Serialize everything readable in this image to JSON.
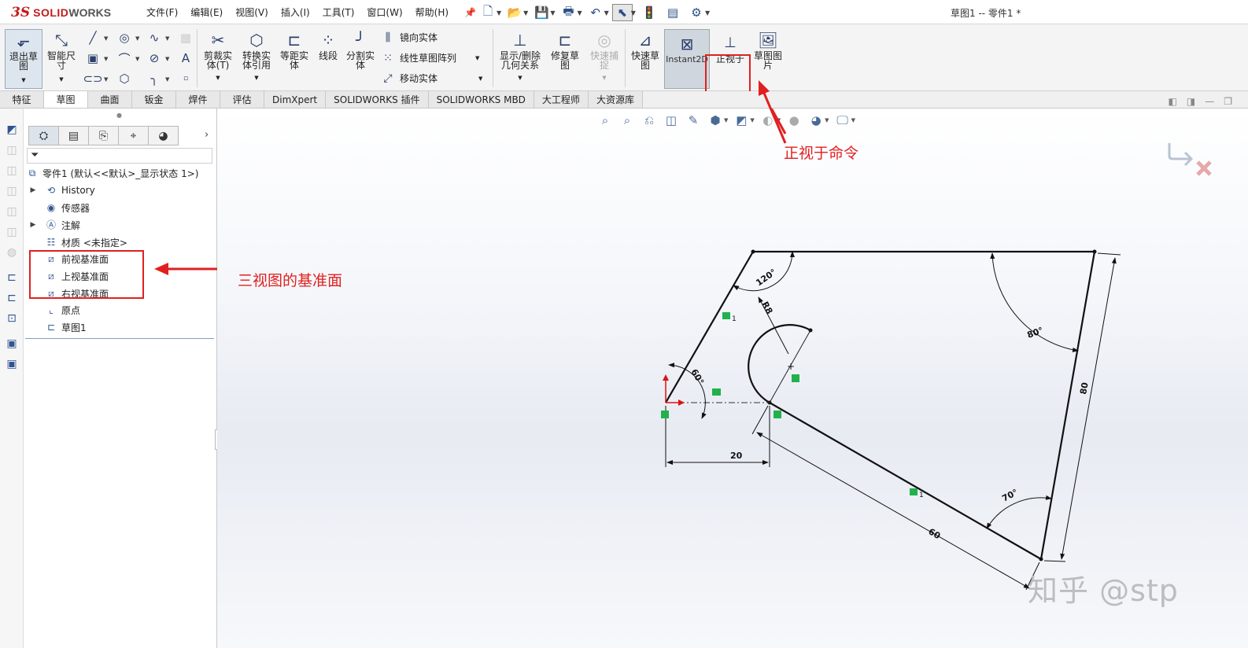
{
  "app": {
    "logo_ds": "3S",
    "logo_solid": "SOLID",
    "logo_works": "WORKS",
    "document_title": "草图1 -- 零件1 *"
  },
  "menu": [
    "文件(F)",
    "编辑(E)",
    "视图(V)",
    "插入(I)",
    "工具(T)",
    "窗口(W)",
    "帮助(H)"
  ],
  "quick_access_icons": [
    "new-icon",
    "open-icon",
    "save-icon",
    "print-icon",
    "undo-icon",
    "select-icon",
    "rebuild-icon",
    "file-properties-icon",
    "options-icon"
  ],
  "ribbon": {
    "exit_sketch": "退出草图",
    "smart_dimension": "智能尺寸",
    "trim": "剪裁实体(T)",
    "convert": "转换实体引用",
    "offset": "等距实体",
    "segment": "线段",
    "split": "分割实体",
    "mirror": "镜向实体",
    "linear_pattern": "线性草图阵列",
    "move": "移动实体",
    "show_delete_relations": "显示/删除几何关系",
    "repair_sketch": "修复草图",
    "quick_snaps": "快速捕捉",
    "rapid_sketch": "快速草图",
    "instant2d": "Instant2D",
    "normal_to": "正视于",
    "sketch_picture": "草图图片"
  },
  "tabs": [
    "特征",
    "草图",
    "曲面",
    "钣金",
    "焊件",
    "评估",
    "DimXpert",
    "SOLIDWORKS 插件",
    "SOLIDWORKS MBD",
    "大工程师",
    "大资源库"
  ],
  "active_tab": "草图",
  "tree": {
    "root": "零件1  (默认<<默认>_显示状态 1>)",
    "items": [
      {
        "label": "History",
        "icon": "history-icon",
        "expandable": true
      },
      {
        "label": "传感器",
        "icon": "sensor-icon",
        "expandable": false
      },
      {
        "label": "注解",
        "icon": "annotation-icon",
        "expandable": true
      },
      {
        "label": "材质 <未指定>",
        "icon": "material-icon",
        "expandable": false
      },
      {
        "label": "前视基准面",
        "icon": "plane-icon",
        "expandable": false
      },
      {
        "label": "上视基准面",
        "icon": "plane-icon",
        "expandable": false
      },
      {
        "label": "右视基准面",
        "icon": "plane-icon",
        "expandable": false
      },
      {
        "label": "原点",
        "icon": "origin-icon",
        "expandable": false
      },
      {
        "label": "草图1",
        "icon": "sketch-icon",
        "expandable": false
      }
    ]
  },
  "sketch": {
    "dimensions": {
      "angle_top_left": "120°",
      "radius": "R8",
      "angle_top_right": "80°",
      "angle_left": "60°",
      "horizontal": "20",
      "right_edge": "80",
      "bottom_edge": "60",
      "angle_bottom": "70°"
    },
    "relation_marks": [
      "1",
      "1"
    ]
  },
  "annotations": {
    "normal_to_note": "正视于命令",
    "planes_note": "三视图的基准面"
  },
  "watermark": "知乎 @stp",
  "colors": {
    "accent_red": "#e02020",
    "sketch_line": "#111111",
    "relation_green": "#22b14c",
    "logo_red": "#c41a1a"
  }
}
